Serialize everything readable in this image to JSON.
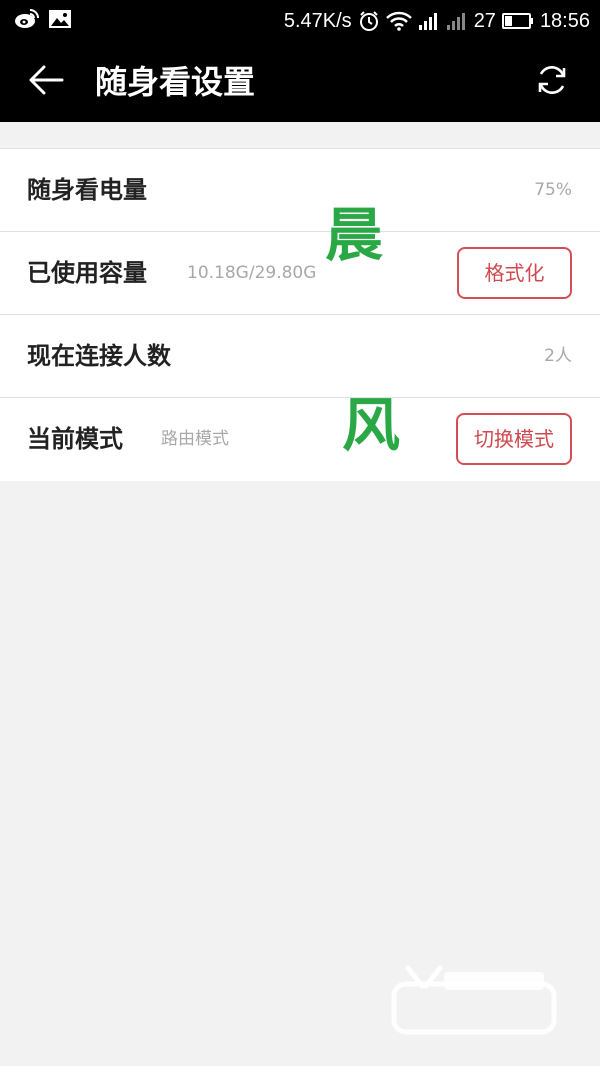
{
  "status_bar": {
    "net_speed": "5.47K/s",
    "battery_level": "27",
    "time": "18:56",
    "icons": [
      "weibo-icon",
      "image-icon",
      "alarm-icon",
      "wifi-icon",
      "signal-icon",
      "signal-icon",
      "battery-icon"
    ]
  },
  "app_bar": {
    "title": "随身看设置",
    "back_icon": "back-arrow-icon",
    "refresh_icon": "refresh-icon"
  },
  "settings": {
    "battery": {
      "label": "随身看电量",
      "value": "75%"
    },
    "storage": {
      "label": "已使用容量",
      "value": "10.18G/29.80G",
      "button": "格式化"
    },
    "connections": {
      "label": "现在连接人数",
      "value": "2人"
    },
    "mode": {
      "label": "当前模式",
      "value": "路由模式",
      "button": "切换模式"
    }
  },
  "overlay": {
    "char1": "晨",
    "char2": "风"
  },
  "colors": {
    "accent": "#cf4a50",
    "overlay_green": "#2aa845",
    "bar": "#000000",
    "background": "#f2f2f2"
  }
}
